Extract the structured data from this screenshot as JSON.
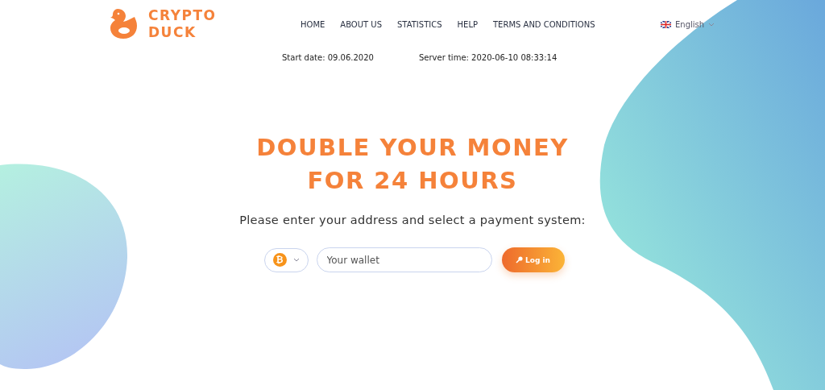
{
  "logo": {
    "line_1": "CRYPTO",
    "line_2": "DUCK"
  },
  "nav": [
    {
      "label": "HOME"
    },
    {
      "label": "ABOUT US"
    },
    {
      "label": "STATISTICS"
    },
    {
      "label": "HELP"
    },
    {
      "label": "TERMS AND CONDITIONS"
    }
  ],
  "language": {
    "label": "English"
  },
  "info": {
    "start_date": "Start date: 09.06.2020",
    "server_time": "Server time: 2020-06-10 08:33:14"
  },
  "hero": {
    "title_line_1": "DOUBLE YOUR MONEY",
    "title_line_2": "FOR 24 HOURS",
    "subtitle": "Please enter your address and select a payment system:"
  },
  "form": {
    "currency_symbol": "₿",
    "wallet": {
      "placeholder": "Your wallet"
    },
    "button": "Log in"
  }
}
